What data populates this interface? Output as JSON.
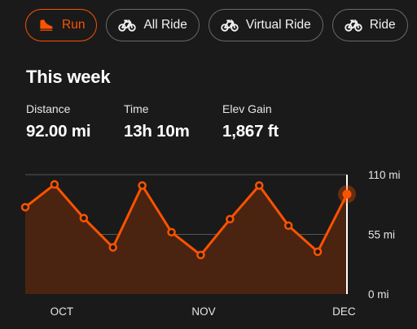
{
  "filters": [
    {
      "label": "Run",
      "icon": "shoe-icon",
      "active": true
    },
    {
      "label": "All Ride",
      "icon": "bike-icon",
      "active": false
    },
    {
      "label": "Virtual Ride",
      "icon": "bike-icon",
      "active": false
    },
    {
      "label": "Ride",
      "icon": "bike-icon",
      "active": false
    }
  ],
  "summary": {
    "title": "This week",
    "stats": [
      {
        "label": "Distance",
        "value": "92.00 mi"
      },
      {
        "label": "Time",
        "value": "13h 10m"
      },
      {
        "label": "Elev Gain",
        "value": "1,867 ft"
      }
    ]
  },
  "colors": {
    "accent": "#fc5200",
    "background": "#1a1a1a",
    "area_fill": "#4a2410"
  },
  "chart_data": {
    "type": "area",
    "unit": "mi",
    "ylim": [
      0,
      110
    ],
    "y_ticks": [
      {
        "value": 110,
        "label": "110 mi"
      },
      {
        "value": 55,
        "label": "55 mi"
      },
      {
        "value": 0,
        "label": "0 mi"
      }
    ],
    "x_labels": [
      "OCT",
      "NOV",
      "DEC"
    ],
    "series": [
      {
        "values": [
          80,
          101,
          70,
          43,
          100,
          57,
          36,
          69,
          100,
          63,
          39,
          92
        ]
      }
    ],
    "highlight_index": 11
  }
}
